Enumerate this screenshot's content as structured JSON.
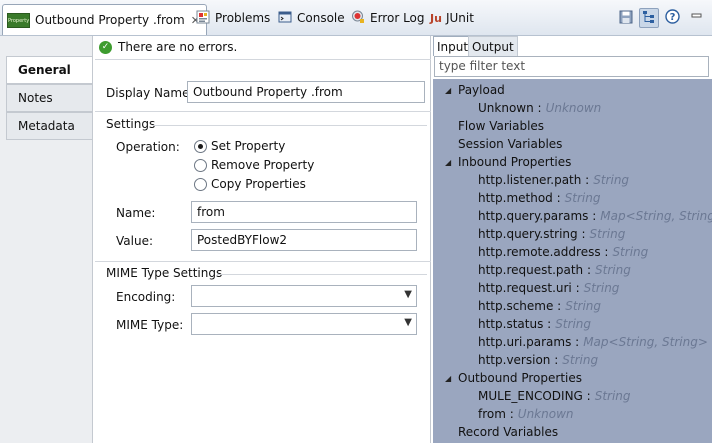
{
  "tabs": {
    "editor_tab": {
      "label": "Outbound Property .from",
      "icon": "property-icon",
      "icon_text": "Property",
      "close_glyph": "✕"
    },
    "problems": {
      "label": "Problems",
      "icon": "problems-icon"
    },
    "console": {
      "label": "Console",
      "icon": "console-icon"
    },
    "error_log": {
      "label": "Error Log",
      "icon": "error-log-icon"
    },
    "junit": {
      "label": "JUnit",
      "icon": "junit-icon",
      "icon_text": "Ju"
    }
  },
  "toolbar": {
    "buttons": [
      "save-icon",
      "hierarchy-icon",
      "help-icon",
      "minimize-icon"
    ]
  },
  "sidebar": {
    "items": [
      {
        "label": "General",
        "active": true
      },
      {
        "label": "Notes",
        "active": false
      },
      {
        "label": "Metadata",
        "active": false
      }
    ]
  },
  "form": {
    "status": "There are no errors.",
    "display_name_label": "Display Name:",
    "display_name_value": "Outbound Property .from",
    "settings_title": "Settings",
    "operation_label": "Operation:",
    "operations": [
      {
        "label": "Set Property",
        "selected": true
      },
      {
        "label": "Remove Property",
        "selected": false
      },
      {
        "label": "Copy Properties",
        "selected": false
      }
    ],
    "name_label": "Name:",
    "name_value": "from",
    "value_label": "Value:",
    "value_value": "PostedBYFlow2",
    "mime_title": "MIME Type Settings",
    "encoding_label": "Encoding:",
    "encoding_value": "",
    "mime_type_label": "MIME Type:",
    "mime_type_value": ""
  },
  "metadata": {
    "tabs": [
      {
        "label": "Input",
        "active": true
      },
      {
        "label": "Output",
        "active": false
      }
    ],
    "filter_placeholder": "type filter text",
    "tree": [
      {
        "label": "Payload",
        "type": "",
        "level": 0,
        "expanded": true
      },
      {
        "label": "Unknown :",
        "type": "Unknown",
        "level": 1
      },
      {
        "label": "Flow Variables",
        "type": "",
        "level": 0
      },
      {
        "label": "Session Variables",
        "type": "",
        "level": 0
      },
      {
        "label": "Inbound Properties",
        "type": "",
        "level": 0,
        "expanded": true
      },
      {
        "label": "http.listener.path :",
        "type": "String",
        "level": 1
      },
      {
        "label": "http.method :",
        "type": "String",
        "level": 1
      },
      {
        "label": "http.query.params :",
        "type": "Map<String, String>",
        "level": 1
      },
      {
        "label": "http.query.string :",
        "type": "String",
        "level": 1
      },
      {
        "label": "http.remote.address :",
        "type": "String",
        "level": 1
      },
      {
        "label": "http.request.path :",
        "type": "String",
        "level": 1
      },
      {
        "label": "http.request.uri :",
        "type": "String",
        "level": 1
      },
      {
        "label": "http.scheme :",
        "type": "String",
        "level": 1
      },
      {
        "label": "http.status :",
        "type": "String",
        "level": 1
      },
      {
        "label": "http.uri.params :",
        "type": "Map<String, String>",
        "level": 1
      },
      {
        "label": "http.version :",
        "type": "String",
        "level": 1
      },
      {
        "label": "Outbound Properties",
        "type": "",
        "level": 0,
        "expanded": true
      },
      {
        "label": "MULE_ENCODING :",
        "type": "String",
        "level": 1
      },
      {
        "label": "from :",
        "type": "Unknown",
        "level": 1
      },
      {
        "label": "Record Variables",
        "type": "",
        "level": 0
      }
    ]
  },
  "colors": {
    "tree_background": "#9aa6bf",
    "ok_green": "#3e9c2f"
  }
}
